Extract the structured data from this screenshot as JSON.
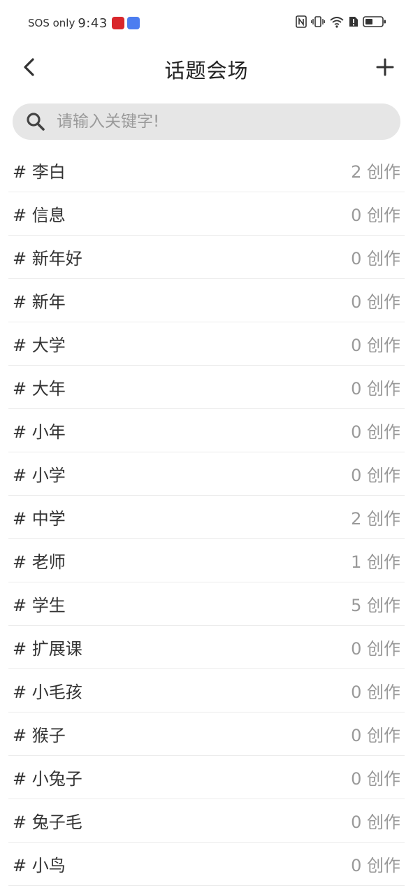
{
  "status_bar": {
    "carrier": "SOS only",
    "time": "9:43"
  },
  "header": {
    "title": "话题会场"
  },
  "search": {
    "placeholder": "请输入关键字!"
  },
  "topics": [
    {
      "name": "# 李白",
      "count": "2 创作"
    },
    {
      "name": "# 信息",
      "count": "0 创作"
    },
    {
      "name": "# 新年好",
      "count": "0 创作"
    },
    {
      "name": "# 新年",
      "count": "0 创作"
    },
    {
      "name": "# 大学",
      "count": "0 创作"
    },
    {
      "name": "# 大年",
      "count": "0 创作"
    },
    {
      "name": "# 小年",
      "count": "0 创作"
    },
    {
      "name": "# 小学",
      "count": "0 创作"
    },
    {
      "name": "# 中学",
      "count": "2 创作"
    },
    {
      "name": "# 老师",
      "count": "1 创作"
    },
    {
      "name": "# 学生",
      "count": "5 创作"
    },
    {
      "name": "# 扩展课",
      "count": "0 创作"
    },
    {
      "name": "# 小毛孩",
      "count": "0 创作"
    },
    {
      "name": "# 猴子",
      "count": "0 创作"
    },
    {
      "name": "# 小兔子",
      "count": "0 创作"
    },
    {
      "name": "# 兔子毛",
      "count": "0 创作"
    },
    {
      "name": "# 小鸟",
      "count": "0 创作"
    }
  ]
}
